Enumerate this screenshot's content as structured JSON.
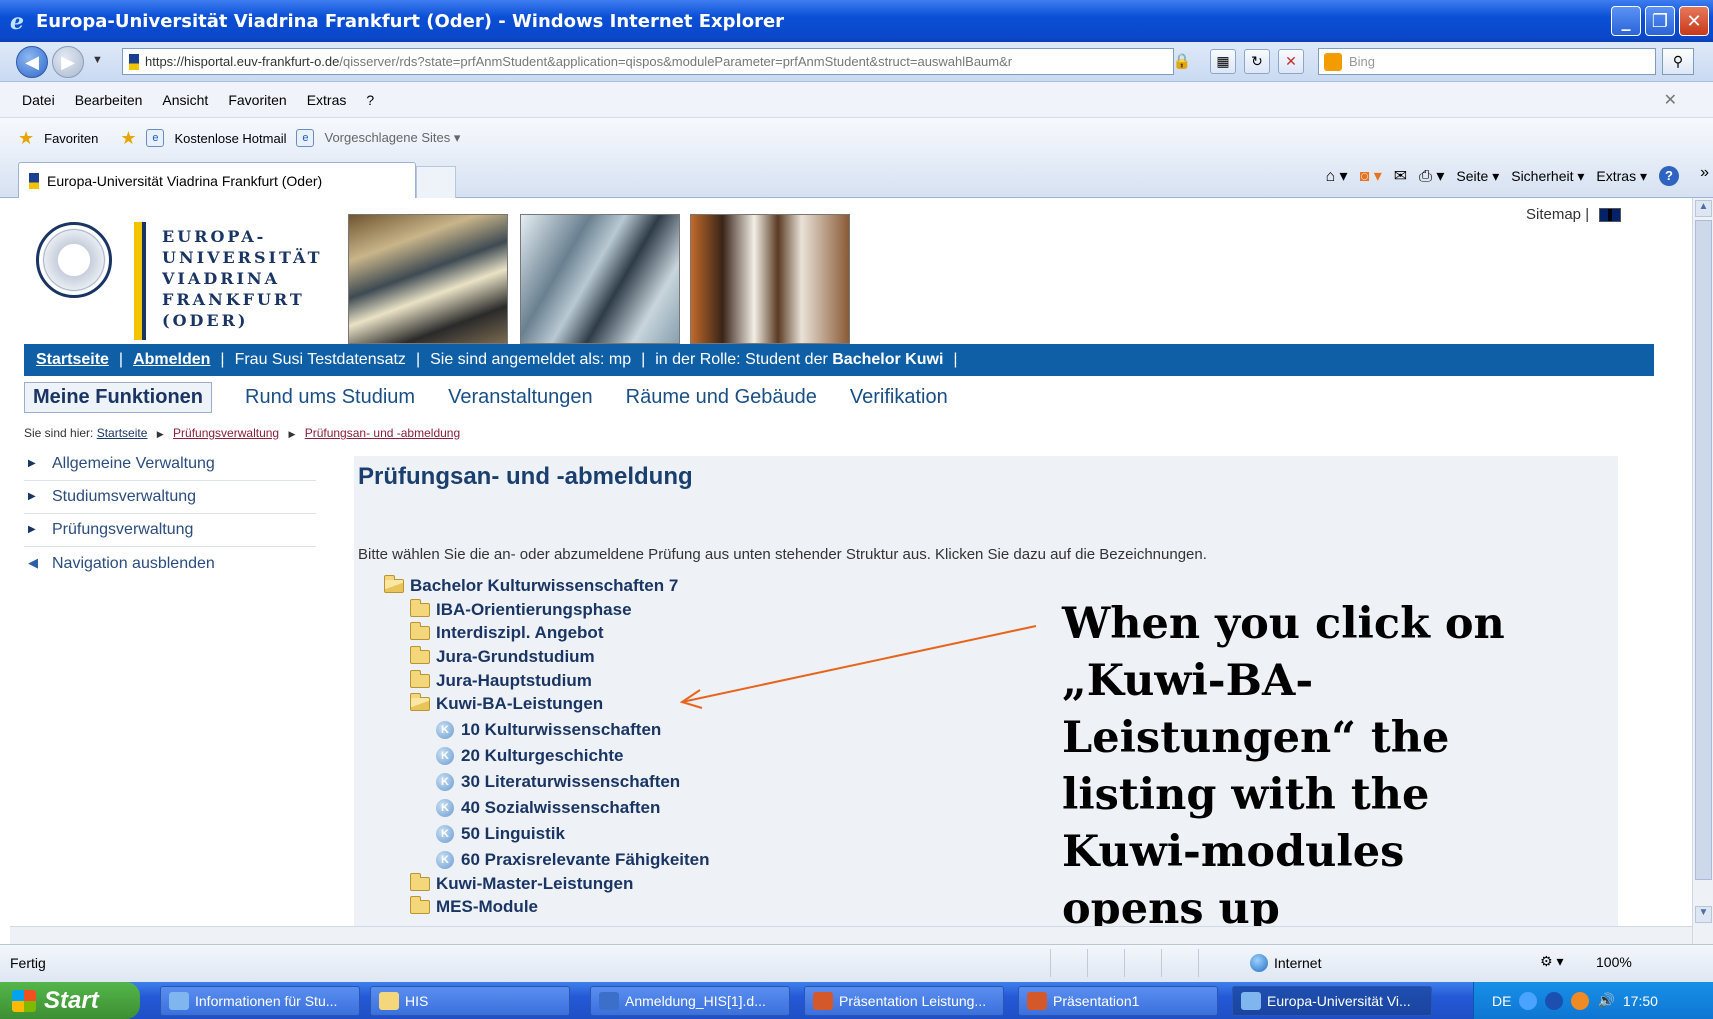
{
  "window": {
    "title": "Europa-Universität Viadrina Frankfurt (Oder) - Windows Internet Explorer",
    "buttons": [
      "_",
      "❐",
      "✕"
    ]
  },
  "address": {
    "url_host": "https://hisportal.euv-frankfurt-o.de",
    "url_path": "/qisserver/rds?state=prfAnmStudent&application=qispos&moduleParameter=prfAnmStudent&struct=auswahlBaum&r",
    "search_placeholder": "Bing"
  },
  "menu": [
    "Datei",
    "Bearbeiten",
    "Ansicht",
    "Favoriten",
    "Extras",
    "?"
  ],
  "favorites": {
    "label": "Favoriten",
    "items": [
      "Kostenlose Hotmail",
      "Vorgeschlagene Sites ▾"
    ]
  },
  "tab": {
    "label": "Europa-Universität Viadrina Frankfurt (Oder)"
  },
  "commandbar": {
    "page": "Seite ▾",
    "security": "Sicherheit ▾",
    "tools": "Extras ▾"
  },
  "site": {
    "logo_lines": [
      "EUROPA-",
      "UNIVERSITÄT",
      "VIADRINA",
      "FRANKFURT",
      "(ODER)"
    ],
    "sitemap": "Sitemap",
    "bluebar": {
      "home": "Startseite",
      "logout": "Abmelden",
      "user": "Frau Susi Testdatensatz",
      "login_as": "Sie sind angemeldet als: mp",
      "role_prefix": "in der Rolle: Student der",
      "role": "Bachelor Kuwi"
    },
    "topnav": [
      "Meine Funktionen",
      "Rund ums Studium",
      "Veranstaltungen",
      "Räume und Gebäude",
      "Verifikation"
    ],
    "breadcrumb": {
      "prefix": "Sie sind hier:",
      "items": [
        "Startseite",
        "Prüfungsverwaltung",
        "Prüfungsan- und -abmeldung"
      ]
    },
    "leftnav": [
      "Allgemeine Verwaltung",
      "Studiumsverwaltung",
      "Prüfungsverwaltung",
      "Navigation ausblenden"
    ],
    "content": {
      "title": "Prüfungsan- und -abmeldung",
      "intro": "Bitte wählen Sie die an- oder abzumeldene Prüfung aus unten stehender Struktur aus. Klicken Sie dazu auf die Bezeichnungen.",
      "root": "Bachelor Kulturwissenschaften 7",
      "folders": [
        "IBA-Orientierungsphase",
        "Interdiszipl. Angebot",
        "Jura-Grundstudium",
        "Jura-Hauptstudium",
        "Kuwi-BA-Leistungen"
      ],
      "modules": [
        "10 Kulturwissenschaften",
        "20 Kulturgeschichte",
        "30 Literaturwissenschaften",
        "40 Sozialwissenschaften",
        "50 Linguistik",
        "60 Praxisrelevante Fähigkeiten"
      ],
      "folders_after": [
        "Kuwi-Master-Leistungen",
        "MES-Module"
      ]
    }
  },
  "annotation": {
    "lines": [
      "When you click on",
      "„Kuwi-BA-",
      "Leistungen“ the",
      "listing with the",
      "Kuwi-modules",
      "opens up"
    ],
    "arrow_color": "#e8641b"
  },
  "status": {
    "text": "Fertig",
    "zone": "Internet",
    "zoom": "100%"
  },
  "taskbar": {
    "start": "Start",
    "items": [
      "Informationen für Stu...",
      "HIS",
      "Anmeldung_HIS[1].d...",
      "Präsentation Leistung...",
      "Präsentation1",
      "Europa-Universität Vi..."
    ],
    "lang": "DE",
    "time": "17:50"
  }
}
